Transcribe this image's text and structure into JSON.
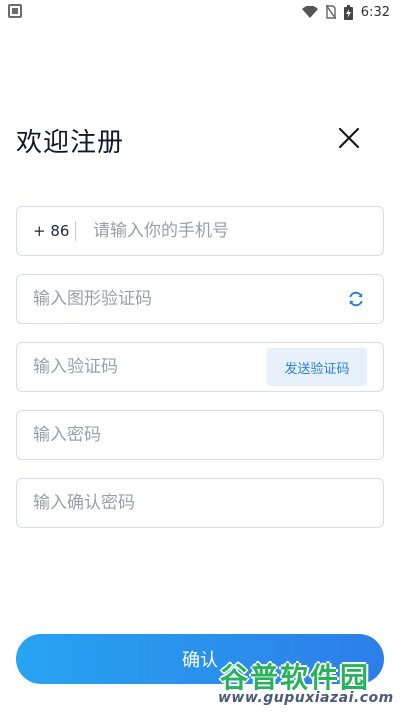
{
  "status_bar": {
    "time": "6:32",
    "icons": [
      "notification-a-icon",
      "wifi-icon",
      "no-sim-icon",
      "battery-charging-icon"
    ]
  },
  "header": {
    "title": "欢迎注册",
    "close_icon": "close-icon"
  },
  "form": {
    "phone": {
      "prefix": "+ 86",
      "placeholder": "请输入你的手机号",
      "value": ""
    },
    "captcha": {
      "placeholder": "输入图形验证码",
      "value": "",
      "refresh_icon": "refresh-icon"
    },
    "sms_code": {
      "placeholder": "输入验证码",
      "value": "",
      "send_label": "发送验证码"
    },
    "password": {
      "placeholder": "输入密码",
      "value": ""
    },
    "confirm_password": {
      "placeholder": "输入确认密码",
      "value": ""
    }
  },
  "confirm_button": {
    "label": "确认"
  },
  "watermark": {
    "title": "谷普软件园",
    "url": "www.gupuxiazai.com"
  },
  "colors": {
    "accent_start": "#27a4f2",
    "accent_end": "#2d7ee8",
    "send_code_bg": "#e6f0fb",
    "send_code_text": "#2f7fd8",
    "border": "#d9dde5",
    "placeholder": "#9aa0ab"
  }
}
